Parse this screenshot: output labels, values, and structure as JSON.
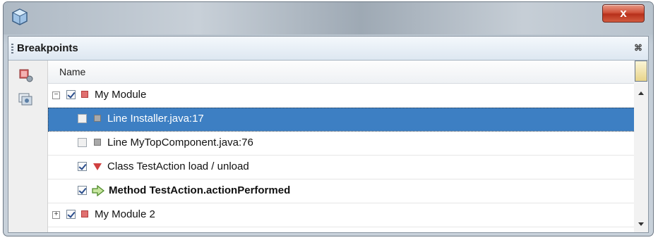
{
  "window": {
    "close_label": "x"
  },
  "panel": {
    "title": "Breakpoints",
    "close_label": "⌘"
  },
  "table": {
    "column_header": "Name",
    "rows": [
      {
        "label": "My Module",
        "type": "group",
        "expander": "−",
        "checked": true,
        "icon": "red-square-icon",
        "selected": false,
        "bold": false
      },
      {
        "label": "Line Installer.java:17",
        "type": "line",
        "checked": false,
        "icon": "gray-square-icon",
        "selected": true,
        "bold": false
      },
      {
        "label": "Line MyTopComponent.java:76",
        "type": "line",
        "checked": false,
        "icon": "gray-square-icon",
        "selected": false,
        "bold": false
      },
      {
        "label": "Class TestAction load / unload",
        "type": "class",
        "checked": true,
        "icon": "red-triangle-icon",
        "selected": false,
        "bold": false
      },
      {
        "label": "Method TestAction.actionPerformed",
        "type": "method",
        "checked": true,
        "icon": "green-arrow-icon",
        "selected": false,
        "bold": true
      },
      {
        "label": "My Module 2",
        "type": "group",
        "expander": "+",
        "checked": true,
        "icon": "red-square-icon",
        "selected": false,
        "bold": false
      }
    ]
  },
  "colors": {
    "selection": "#3d7fc3",
    "close_button": "#c9402a",
    "breakpoint_red": "#e07070"
  }
}
